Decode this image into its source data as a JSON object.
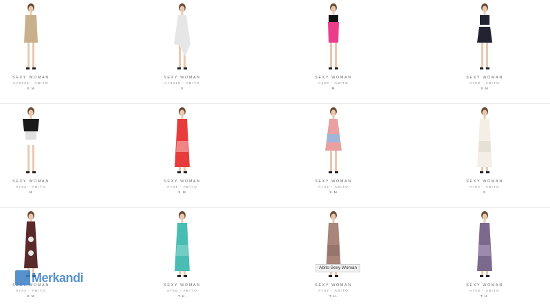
{
  "products": [
    {
      "brand": "SEXY WOMAN",
      "code": "A70436 - ABITO",
      "sizes": "S M",
      "colors": [
        "#c9b08c",
        "#b39b78"
      ],
      "skin": "#e8c8ae",
      "style": "short"
    },
    {
      "brand": "SEXY WOMAN",
      "code": "A70416 - ABITO",
      "sizes": "S",
      "colors": [
        "#e6e6e6",
        "#cfcfcf"
      ],
      "skin": "#e8c8ae",
      "style": "hilo"
    },
    {
      "brand": "SEXY WOMAN",
      "code": "A408 - ABITO",
      "sizes": "M",
      "colors": [
        "#ec3c8c",
        "#111111"
      ],
      "skin": "#e8c8ae",
      "style": "pencil"
    },
    {
      "brand": "SEXY WOMAN",
      "code": "A708 - ABITO",
      "sizes": "S M",
      "colors": [
        "#222233",
        "#f2f2f2"
      ],
      "skin": "#e8c8ae",
      "style": "skirt"
    },
    {
      "brand": "SEXY WOMAN",
      "code": "A733 - ABITO",
      "sizes": "M",
      "colors": [
        "#1a1a1a",
        "#e0e0e0"
      ],
      "skin": "#e8c8ae",
      "style": "top"
    },
    {
      "brand": "SEXY WOMAN",
      "code": "A741 - ABITO",
      "sizes": "S M",
      "colors": [
        "#e83c3c",
        "#f5b5b5"
      ],
      "skin": "#e8c8ae",
      "style": "maxi"
    },
    {
      "brand": "SEXY WOMAN",
      "code": "A742 - ABITO",
      "sizes": "S M",
      "colors": [
        "#e8a0a0",
        "#9fb6d8"
      ],
      "skin": "#e8c8ae",
      "style": "tunic"
    },
    {
      "brand": "SEXY WOMAN",
      "code": "A784 - ABITO",
      "sizes": "S",
      "colors": [
        "#f3efe6",
        "#ddd7c8"
      ],
      "skin": "#e8c8ae",
      "style": "maxi"
    },
    {
      "brand": "SEXY WOMAN",
      "code": "A743 - ABITO",
      "sizes": "S M",
      "colors": [
        "#5a2a2a",
        "#e7e7e7"
      ],
      "skin": "#e8c8ae",
      "style": "halter"
    },
    {
      "brand": "SEXY WOMAN",
      "code": "A746 - ABITO",
      "sizes": "T.U.",
      "colors": [
        "#49bdb3",
        "#8fd7cf"
      ],
      "skin": "#e8c8ae",
      "style": "maxi"
    },
    {
      "brand": "SEXY WOMAN",
      "code": "A747 - ABITO",
      "sizes": "T.U.",
      "colors": [
        "#a9857a",
        "#8d6b62"
      ],
      "skin": "#e8c8ae",
      "style": "maxi"
    },
    {
      "brand": "SEXY WOMAN",
      "code": "A748 - ABITO",
      "sizes": "T.U.",
      "colors": [
        "#7b6a8d",
        "#b2a1c5"
      ],
      "skin": "#e8c8ae",
      "style": "maxi"
    }
  ],
  "tooltip": "Abito Sexy Woman",
  "watermark": "Merkandi",
  "accent": "#3a7fc4"
}
